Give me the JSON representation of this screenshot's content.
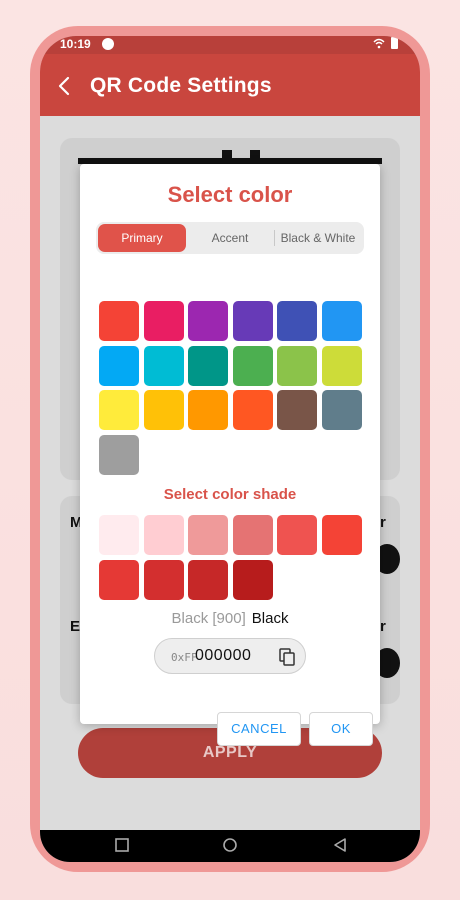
{
  "status_bar": {
    "time": "10:19"
  },
  "app_bar": {
    "title": "QR Code Settings"
  },
  "background": {
    "left_letters": [
      "M",
      "E"
    ],
    "right_letters": [
      "r",
      "r"
    ],
    "apply_label": "APPLY"
  },
  "dialog": {
    "title": "Select color",
    "tabs": [
      {
        "label": "Primary",
        "active": true
      },
      {
        "label": "Accent",
        "active": false
      },
      {
        "label": "Black & White",
        "active": false
      }
    ],
    "primary_colors": [
      "#f44336",
      "#e91e63",
      "#9c27b0",
      "#673ab7",
      "#3f51b5",
      "#2196f3",
      "#03a9f4",
      "#00bcd4",
      "#009688",
      "#4caf50",
      "#8bc34a",
      "#cddc39",
      "#ffeb3b",
      "#ffc107",
      "#ff9800",
      "#ff5722",
      "#795548",
      "#607d8b",
      "#9e9e9e"
    ],
    "shade_title": "Select color shade",
    "shade_colors": [
      "#ffebee",
      "#ffcdd2",
      "#ef9a9a",
      "#e57373",
      "#ef5350",
      "#f44336",
      "#e53935",
      "#d32f2f",
      "#c62828",
      "#b71c1c"
    ],
    "color_name_code": "Black [900]",
    "color_name": "Black",
    "hex_prefix": "0xFF",
    "hex_value": "000000",
    "cancel_label": "CANCEL",
    "ok_label": "OK"
  },
  "colors": {
    "accent": "#d9534a",
    "app_bar": "#c9463e",
    "button_text": "#2196f3"
  }
}
